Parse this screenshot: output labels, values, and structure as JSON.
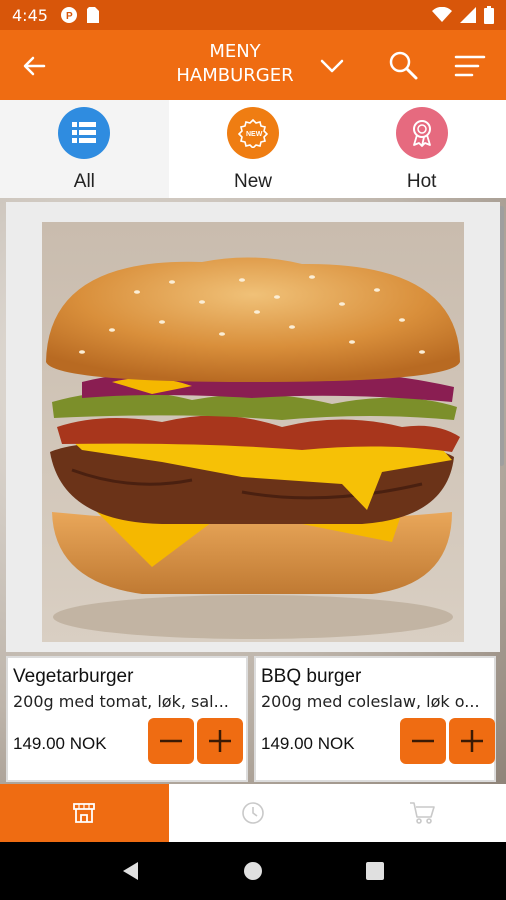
{
  "status_bar": {
    "time": "4:45"
  },
  "app_bar": {
    "title_line1": "MENY",
    "title_line2": "HAMBURGER"
  },
  "filters": [
    {
      "label": "All",
      "icon": "list-icon",
      "color": "#2f8ce0",
      "active": true
    },
    {
      "label": "New",
      "icon": "new-badge-icon",
      "color": "#ef7d12",
      "active": false
    },
    {
      "label": "Hot",
      "icon": "award-ribbon-icon",
      "color": "#e66a7f",
      "active": false
    }
  ],
  "products": [
    {
      "name": "Vegetarburger",
      "description": "200g med tomat, løk, sal...",
      "price": "149.00 NOK"
    },
    {
      "name": "BBQ burger",
      "description": "200g med coleslaw, løk o...",
      "price": "149.00 NOK"
    }
  ],
  "bottom_nav": [
    {
      "icon": "store-icon",
      "active": true
    },
    {
      "icon": "clock-icon",
      "active": false
    },
    {
      "icon": "cart-icon",
      "active": false
    }
  ],
  "colors": {
    "accent": "#ef6c12",
    "status_bar": "#d8560a"
  }
}
